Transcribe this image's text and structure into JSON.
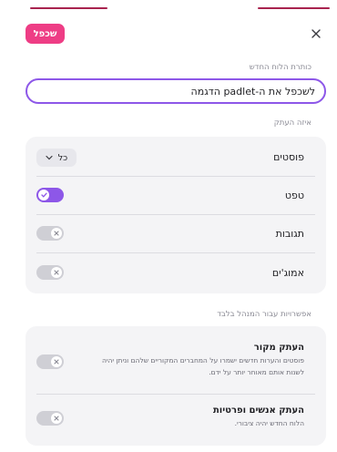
{
  "header": {
    "duplicate_label": "שכפל",
    "close_icon": "close-icon"
  },
  "name_field": {
    "label": "כותרת הלוח החדש",
    "value": "לשכפל את ה-padlet הדגמה"
  },
  "copy_section": {
    "label": "איזה העתק",
    "posts": {
      "label": "פוסטים",
      "select_value": "כל"
    },
    "wallpaper": {
      "label": "טפט",
      "enabled": true
    },
    "comments": {
      "label": "תגובות",
      "enabled": false
    },
    "reactions": {
      "label": "אמוג'ים",
      "enabled": false
    }
  },
  "admin_section": {
    "label": "אפשרויות עבור המנהל בלבד",
    "copy_source": {
      "title": "העתק מקור",
      "desc": "פוסטים והערות חדשים ישמרו על המחברים המקוריים שלהם וניתן יהיה לשנות אותם מאוחר יותר על ידם.",
      "enabled": false
    },
    "copy_people": {
      "title": "העתק אנשים ופרטיות",
      "desc": "הלוח החדש יהיה ציבורי.",
      "enabled": false
    }
  },
  "colors": {
    "accent": "#8d57e8",
    "duplicate": "#ee3d85",
    "top_line": "#a8244f"
  }
}
